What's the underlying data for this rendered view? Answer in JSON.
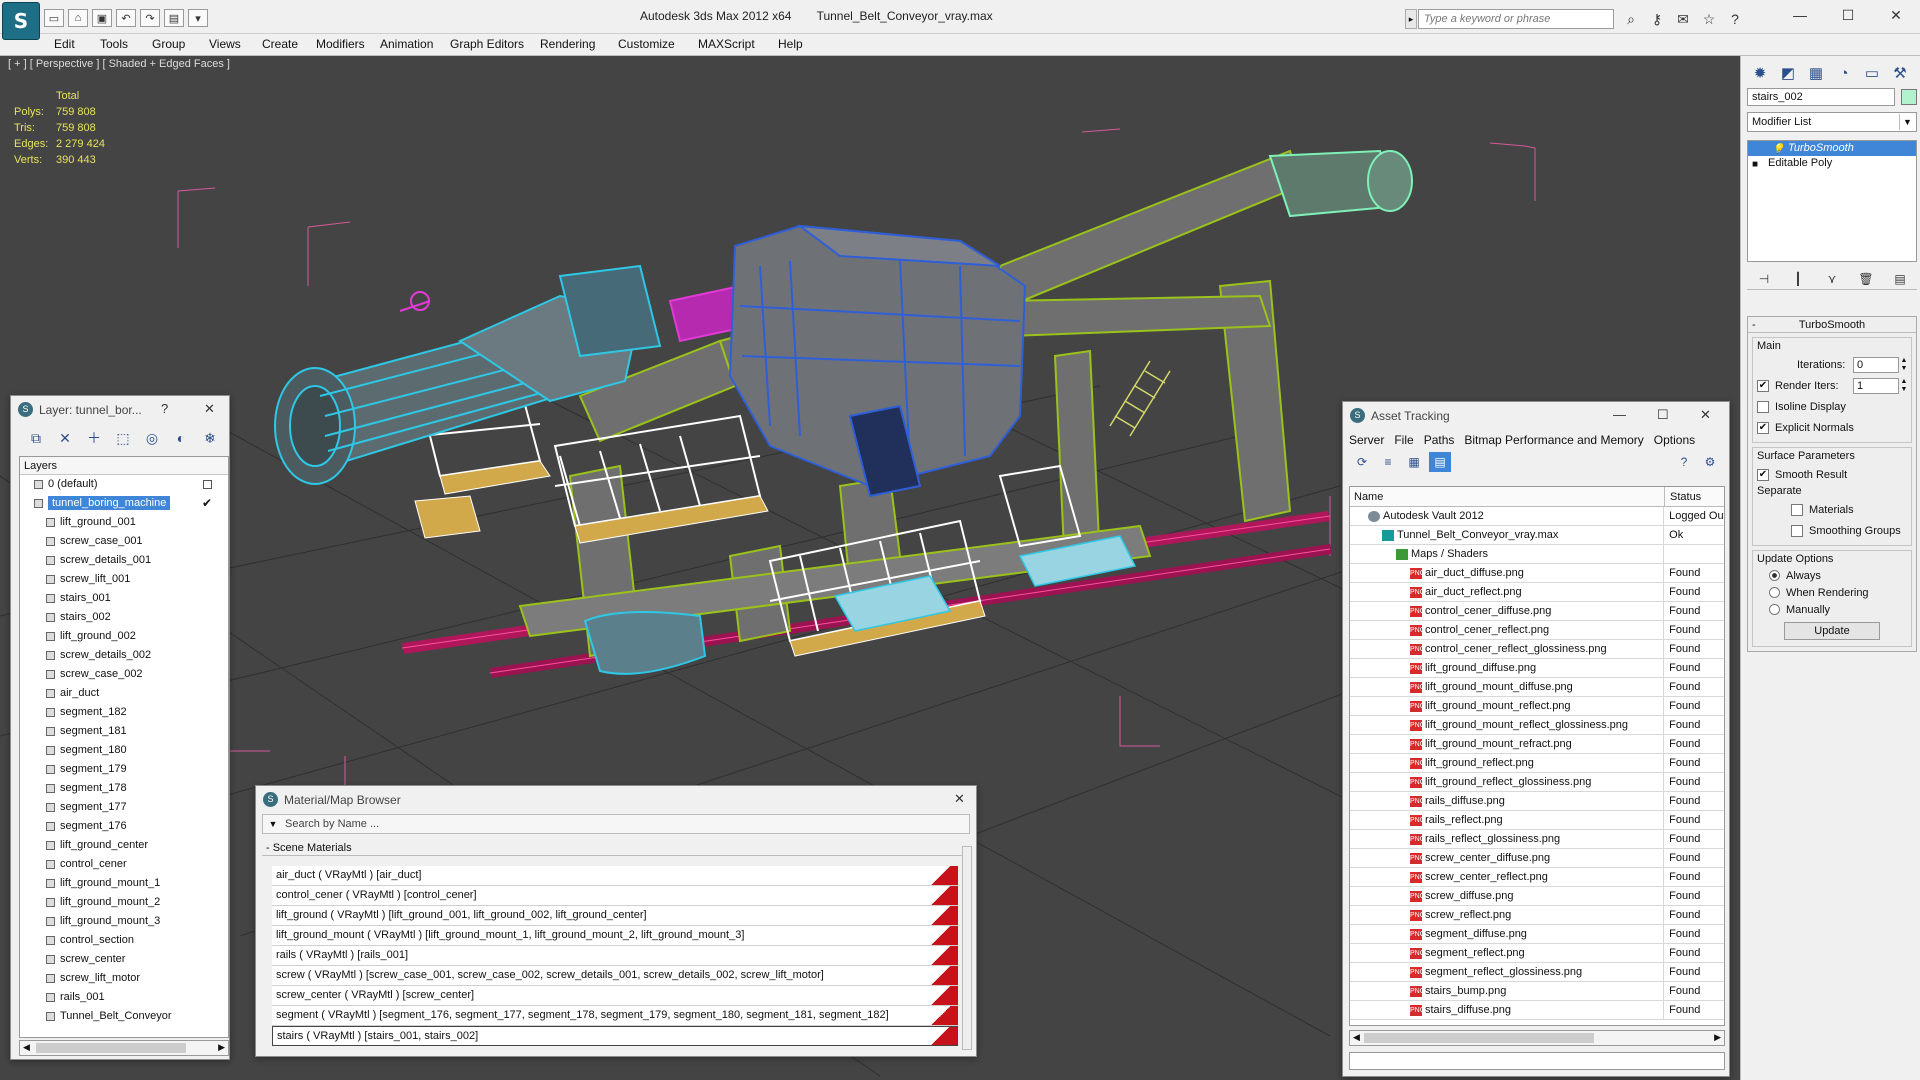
{
  "titlebar": {
    "app_name": "Autodesk 3ds Max  2012 x64",
    "file_name": "Tunnel_Belt_Conveyor_vray.max",
    "search_placeholder": "Type a keyword or phrase"
  },
  "menu": [
    "Edit",
    "Tools",
    "Group",
    "Views",
    "Create",
    "Modifiers",
    "Animation",
    "Graph Editors",
    "Rendering",
    "Customize",
    "MAXScript",
    "Help"
  ],
  "viewport": {
    "label": "[ + ] [ Perspective ] [ Shaded + Edged Faces ]",
    "stats_header": "Total",
    "stats": [
      {
        "k": "Polys:",
        "v": "759 808"
      },
      {
        "k": "Tris:",
        "v": "759 808"
      },
      {
        "k": "Edges:",
        "v": "2 279 424"
      },
      {
        "k": "Verts:",
        "v": "390 443"
      }
    ]
  },
  "command_panel": {
    "object_name": "stairs_002",
    "modifier_list": "Modifier List",
    "stack": [
      "TurboSmooth",
      "Editable Poly"
    ],
    "rollout_title": "TurboSmooth",
    "main_label": "Main",
    "iterations_label": "Iterations:",
    "iterations_value": "0",
    "render_iters_label": "Render Iters:",
    "render_iters_value": "1",
    "isoline_label": "Isoline Display",
    "explicit_label": "Explicit Normals",
    "surface_label": "Surface Parameters",
    "smooth_label": "Smooth Result",
    "separate_label": "Separate",
    "materials_label": "Materials",
    "smoothing_label": "Smoothing Groups",
    "update_label": "Update Options",
    "always_label": "Always",
    "when_rendering_label": "When Rendering",
    "manually_label": "Manually",
    "update_button": "Update"
  },
  "layer_window": {
    "title": "Layer: tunnel_bor...",
    "help": "?",
    "header": "Layers",
    "rows": [
      {
        "name": "0 (default)",
        "level": 1,
        "mark": "box"
      },
      {
        "name": "tunnel_boring_machine",
        "level": 1,
        "selected": true,
        "mark": "check"
      },
      {
        "name": "lift_ground_001",
        "level": 2
      },
      {
        "name": "screw_case_001",
        "level": 2
      },
      {
        "name": "screw_details_001",
        "level": 2
      },
      {
        "name": "screw_lift_001",
        "level": 2
      },
      {
        "name": "stairs_001",
        "level": 2
      },
      {
        "name": "stairs_002",
        "level": 2
      },
      {
        "name": "lift_ground_002",
        "level": 2
      },
      {
        "name": "screw_details_002",
        "level": 2
      },
      {
        "name": "screw_case_002",
        "level": 2
      },
      {
        "name": "air_duct",
        "level": 2
      },
      {
        "name": "segment_182",
        "level": 2
      },
      {
        "name": "segment_181",
        "level": 2
      },
      {
        "name": "segment_180",
        "level": 2
      },
      {
        "name": "segment_179",
        "level": 2
      },
      {
        "name": "segment_178",
        "level": 2
      },
      {
        "name": "segment_177",
        "level": 2
      },
      {
        "name": "segment_176",
        "level": 2
      },
      {
        "name": "lift_ground_center",
        "level": 2
      },
      {
        "name": "control_cener",
        "level": 2
      },
      {
        "name": "lift_ground_mount_1",
        "level": 2
      },
      {
        "name": "lift_ground_mount_2",
        "level": 2
      },
      {
        "name": "lift_ground_mount_3",
        "level": 2
      },
      {
        "name": "control_section",
        "level": 2
      },
      {
        "name": "screw_center",
        "level": 2
      },
      {
        "name": "screw_lift_motor",
        "level": 2
      },
      {
        "name": "rails_001",
        "level": 2
      },
      {
        "name": "Tunnel_Belt_Conveyor",
        "level": 2
      }
    ]
  },
  "material_browser": {
    "title": "Material/Map Browser",
    "search_placeholder": "Search by Name ...",
    "section": "- Scene Materials",
    "rows": [
      "air_duct  ( VRayMtl ) [air_duct]",
      "control_cener  ( VRayMtl ) [control_cener]",
      "lift_ground  ( VRayMtl ) [lift_ground_001, lift_ground_002, lift_ground_center]",
      "lift_ground_mount  ( VRayMtl ) [lift_ground_mount_1, lift_ground_mount_2, lift_ground_mount_3]",
      "rails  ( VRayMtl ) [rails_001]",
      "screw  ( VRayMtl ) [screw_case_001, screw_case_002, screw_details_001, screw_details_002, screw_lift_motor]",
      "screw_center  ( VRayMtl ) [screw_center]",
      "segment  ( VRayMtl ) [segment_176, segment_177, segment_178, segment_179, segment_180, segment_181, segment_182]",
      "stairs  ( VRayMtl ) [stairs_001, stairs_002]"
    ]
  },
  "asset_tracking": {
    "title": "Asset Tracking",
    "menu": [
      "Server",
      "File",
      "Paths",
      "Bitmap Performance and Memory",
      "Options"
    ],
    "col_name": "Name",
    "col_status": "Status",
    "rows": [
      {
        "name": "Autodesk Vault 2012",
        "status": "Logged Out",
        "icon": "vault",
        "indent": 1
      },
      {
        "name": "Tunnel_Belt_Conveyor_vray.max",
        "status": "Ok",
        "icon": "max",
        "indent": 2
      },
      {
        "name": "Maps / Shaders",
        "status": "",
        "icon": "maps",
        "indent": 3
      },
      {
        "name": "air_duct_diffuse.png",
        "status": "Found",
        "icon": "png",
        "indent": 4
      },
      {
        "name": "air_duct_reflect.png",
        "status": "Found",
        "icon": "png",
        "indent": 4
      },
      {
        "name": "control_cener_diffuse.png",
        "status": "Found",
        "icon": "png",
        "indent": 4
      },
      {
        "name": "control_cener_reflect.png",
        "status": "Found",
        "icon": "png",
        "indent": 4
      },
      {
        "name": "control_cener_reflect_glossiness.png",
        "status": "Found",
        "icon": "png",
        "indent": 4
      },
      {
        "name": "lift_ground_diffuse.png",
        "status": "Found",
        "icon": "png",
        "indent": 4
      },
      {
        "name": "lift_ground_mount_diffuse.png",
        "status": "Found",
        "icon": "png",
        "indent": 4
      },
      {
        "name": "lift_ground_mount_reflect.png",
        "status": "Found",
        "icon": "png",
        "indent": 4
      },
      {
        "name": "lift_ground_mount_reflect_glossiness.png",
        "status": "Found",
        "icon": "png",
        "indent": 4
      },
      {
        "name": "lift_ground_mount_refract.png",
        "status": "Found",
        "icon": "png",
        "indent": 4
      },
      {
        "name": "lift_ground_reflect.png",
        "status": "Found",
        "icon": "png",
        "indent": 4
      },
      {
        "name": "lift_ground_reflect_glossiness.png",
        "status": "Found",
        "icon": "png",
        "indent": 4
      },
      {
        "name": "rails_diffuse.png",
        "status": "Found",
        "icon": "png",
        "indent": 4
      },
      {
        "name": "rails_reflect.png",
        "status": "Found",
        "icon": "png",
        "indent": 4
      },
      {
        "name": "rails_reflect_glossiness.png",
        "status": "Found",
        "icon": "png",
        "indent": 4
      },
      {
        "name": "screw_center_diffuse.png",
        "status": "Found",
        "icon": "png",
        "indent": 4
      },
      {
        "name": "screw_center_reflect.png",
        "status": "Found",
        "icon": "png",
        "indent": 4
      },
      {
        "name": "screw_diffuse.png",
        "status": "Found",
        "icon": "png",
        "indent": 4
      },
      {
        "name": "screw_reflect.png",
        "status": "Found",
        "icon": "png",
        "indent": 4
      },
      {
        "name": "segment_diffuse.png",
        "status": "Found",
        "icon": "png",
        "indent": 4
      },
      {
        "name": "segment_reflect.png",
        "status": "Found",
        "icon": "png",
        "indent": 4
      },
      {
        "name": "segment_reflect_glossiness.png",
        "status": "Found",
        "icon": "png",
        "indent": 4
      },
      {
        "name": "stairs_bump.png",
        "status": "Found",
        "icon": "png",
        "indent": 4
      },
      {
        "name": "stairs_diffuse.png",
        "status": "Found",
        "icon": "png",
        "indent": 4
      }
    ]
  },
  "colors": {
    "viewport_bg": "#444444",
    "stats_text": "#e7e25a",
    "selection": "#3f86d8",
    "wire_cyan": "#2ec8e6",
    "wire_blue": "#2f5fd8",
    "wire_green": "#9bc21a",
    "wire_white": "#ffffff",
    "wire_magenta": "#e23ad6",
    "rail_red": "#b0175a"
  }
}
